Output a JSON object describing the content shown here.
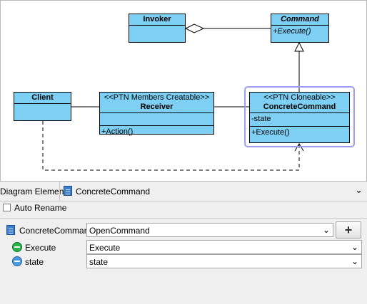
{
  "diagram": {
    "invoker": {
      "name": "Invoker"
    },
    "command": {
      "name": "Command",
      "operation": "+Execute()"
    },
    "client": {
      "name": "Client"
    },
    "receiver": {
      "stereotype": "<<PTN Members Creatable>>",
      "name": "Receiver",
      "operation": "+Action()"
    },
    "concrete_command": {
      "stereotype": "<<PTN Cloneable>>",
      "name": "ConcreteCommand",
      "attribute": "-state",
      "operation": "+Execute()"
    }
  },
  "panel": {
    "header_label": "Diagram Element",
    "selected_element": "ConcreteCommand",
    "auto_rename_label": "Auto Rename",
    "auto_rename_checked": false,
    "rows": [
      {
        "label": "ConcreteCommand",
        "value": "OpenCommand",
        "icon": "class-icon"
      },
      {
        "label": "Execute",
        "value": "Execute",
        "icon": "operation-icon"
      },
      {
        "label": "state",
        "value": "state",
        "icon": "attribute-icon"
      }
    ],
    "add_button_icon": "plus-icon",
    "dropdown_icon": "chevron-down-icon"
  },
  "colors": {
    "class_fill": "#7dcff4",
    "selection_ring": "#9d9df0",
    "panel_bg": "#efefef"
  }
}
